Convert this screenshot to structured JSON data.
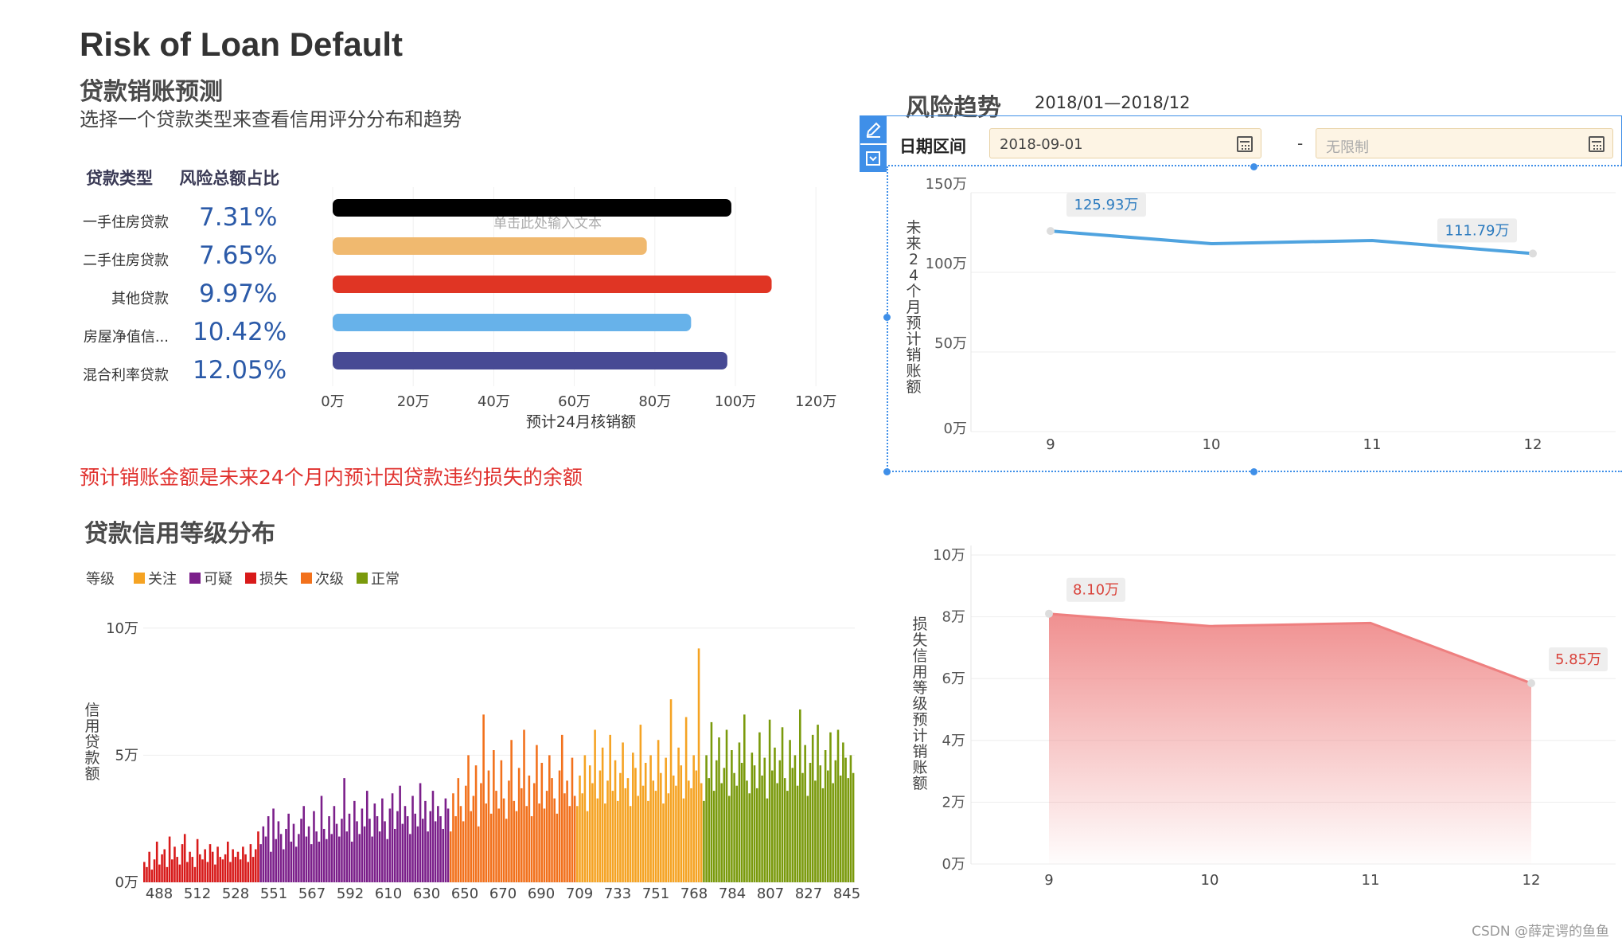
{
  "header": {
    "title": "Risk of Loan Default",
    "subtitle": "贷款销账预测",
    "description": "选择一个贷款类型来查看信用评分分布和趋势"
  },
  "loan_table": {
    "col1": "贷款类型",
    "col2": "风险总额占比",
    "rows": [
      {
        "type": "一手住房贷款",
        "pct": "7.31%",
        "color": "#000000"
      },
      {
        "type": "二手住房贷款",
        "pct": "7.65%",
        "color": "#f0b96f"
      },
      {
        "type": "其他贷款",
        "pct": "9.97%",
        "color": "#e03524"
      },
      {
        "type": "房屋净值信...",
        "pct": "10.42%",
        "color": "#67b2ea"
      },
      {
        "type": "混合利率贷款",
        "pct": "12.05%",
        "color": "#474a94"
      }
    ],
    "placeholder_text": "单击此处输入文本"
  },
  "note": "预计销账金额是未来24个月内预计因贷款违约损失的余额",
  "risk_trend": {
    "title": "风险趋势",
    "range_text": "2018/01—2018/12",
    "filter_label": "日期区间",
    "start_value": "2018-09-01",
    "end_placeholder": "无限制",
    "separator": "-"
  },
  "credit_section": {
    "title": "贷款信用等级分布"
  },
  "watermark": "CSDN @薛定谔的鱼鱼",
  "chart_data": [
    {
      "type": "bar",
      "orientation": "horizontal",
      "categories": [
        "一手住房贷款",
        "二手住房贷款",
        "其他贷款",
        "房屋净值信...",
        "混合利率贷款"
      ],
      "values": [
        99,
        78,
        109,
        89,
        98
      ],
      "xlabel": "预计24月核销额",
      "xticks": [
        "0万",
        "20万",
        "40万",
        "60万",
        "80万",
        "100万",
        "120万"
      ],
      "xlim": [
        0,
        120
      ],
      "colors": [
        "#000000",
        "#f0b96f",
        "#e03524",
        "#67b2ea",
        "#474a94"
      ],
      "grid": true
    },
    {
      "type": "line",
      "x": [
        "9",
        "10",
        "11",
        "12"
      ],
      "values": [
        125.93,
        118,
        120,
        111.79
      ],
      "point_labels": [
        "125.93万",
        "",
        "",
        "111.79万"
      ],
      "ylabel": "未来24个月预计销账额",
      "yticks": [
        "150万",
        "100万",
        "50万",
        "0万"
      ],
      "ylim": [
        0,
        150
      ],
      "color": "#4fa3df",
      "grid": true
    },
    {
      "type": "bar",
      "legend_title": "等级",
      "legend": [
        {
          "name": "关注",
          "color": "#f5a323"
        },
        {
          "name": "可疑",
          "color": "#7b1f8a"
        },
        {
          "name": "损失",
          "color": "#d81a1a"
        },
        {
          "name": "次级",
          "color": "#f2711c"
        },
        {
          "name": "正常",
          "color": "#7a9a0c"
        }
      ],
      "ylabel": "信用贷款额",
      "yticks": [
        "10万",
        "5万",
        "0万"
      ],
      "ylim": [
        0,
        10
      ],
      "xticks": [
        "488",
        "512",
        "528",
        "551",
        "567",
        "592",
        "610",
        "630",
        "650",
        "670",
        "690",
        "709",
        "733",
        "751",
        "768",
        "784",
        "807",
        "827",
        "845"
      ],
      "groups": [
        {
          "grade": "损失",
          "color": "#d81a1a",
          "x_from": 480,
          "x_to": 528,
          "bars": [
            0.8,
            0.6,
            1.2,
            0.5,
            0.9,
            1.6,
            0.7,
            1.1,
            1.3,
            0.6,
            1.8,
            0.9,
            1.4,
            1.0,
            0.7,
            1.5,
            1.9,
            0.8,
            1.2,
            1.0,
            0.6,
            1.7,
            1.1,
            0.9,
            1.3,
            0.8,
            1.5,
            1.2,
            0.7,
            1.4,
            1.0,
            0.9,
            1.1,
            1.6,
            0.8,
            1.3,
            1.0,
            1.2,
            0.9,
            1.4,
            1.1,
            0.8,
            1.5,
            1.0,
            1.3,
            2.0
          ]
        },
        {
          "grade": "可疑",
          "color": "#7b1f8a",
          "x_from": 528,
          "x_to": 630,
          "bars": [
            1.5,
            2.2,
            1.8,
            2.6,
            1.2,
            2.9,
            1.7,
            2.4,
            1.9,
            1.3,
            2.1,
            2.7,
            1.6,
            2.3,
            1.4,
            1.9,
            2.5,
            3.0,
            1.8,
            2.2,
            1.5,
            2.8,
            2.0,
            1.6,
            3.4,
            2.1,
            1.7,
            2.6,
            1.9,
            3.0,
            2.3,
            1.8,
            2.5,
            4.1,
            2.0,
            2.7,
            1.6,
            3.2,
            2.4,
            1.9,
            2.9,
            2.2,
            3.6,
            2.5,
            1.8,
            3.1,
            2.6,
            2.0,
            3.3,
            2.4,
            1.7,
            2.9,
            3.5,
            2.1,
            2.8,
            3.8,
            2.3,
            3.0,
            2.6,
            1.9,
            3.4,
            2.7,
            2.2,
            3.9,
            2.5,
            3.2,
            2.0,
            2.8,
            3.6,
            2.4,
            3.0,
            2.6,
            2.1,
            3.3,
            2.9
          ]
        },
        {
          "grade": "次级",
          "color": "#f2711c",
          "x_from": 630,
          "x_to": 700,
          "bars": [
            2.0,
            3.5,
            2.6,
            4.1,
            3.0,
            2.4,
            3.8,
            5.0,
            2.8,
            3.4,
            4.6,
            2.2,
            3.9,
            6.6,
            3.1,
            4.4,
            2.7,
            5.2,
            3.6,
            2.9,
            4.8,
            3.3,
            2.5,
            4.0,
            5.6,
            3.2,
            2.8,
            4.5,
            3.7,
            6.0,
            3.0,
            4.2,
            2.6,
            3.9,
            5.4,
            3.1,
            4.7,
            2.9,
            3.6,
            5.0,
            4.1,
            3.3,
            2.7,
            4.4,
            5.8,
            3.5,
            4.0,
            3.0,
            4.9,
            3.4
          ]
        },
        {
          "grade": "关注",
          "color": "#f5a323",
          "x_from": 700,
          "x_to": 768,
          "bars": [
            3.0,
            4.2,
            3.5,
            5.0,
            2.8,
            4.6,
            3.9,
            6.0,
            3.3,
            4.4,
            5.3,
            3.1,
            4.0,
            5.8,
            3.6,
            4.8,
            3.2,
            4.3,
            5.5,
            3.7,
            4.1,
            3.0,
            5.1,
            4.5,
            3.4,
            6.2,
            3.8,
            4.7,
            3.2,
            5.0,
            4.0,
            3.6,
            5.6,
            4.3,
            3.1,
            4.9,
            3.5,
            7.2,
            4.2,
            3.8,
            5.3,
            4.6,
            3.3,
            6.5,
            4.0,
            3.7,
            5.0,
            4.4,
            9.2,
            3.9
          ]
        },
        {
          "grade": "正常",
          "color": "#7a9a0c",
          "x_from": 768,
          "x_to": 850,
          "bars": [
            3.2,
            5.0,
            4.1,
            6.3,
            3.6,
            4.8,
            5.7,
            3.9,
            4.5,
            6.0,
            3.4,
            5.2,
            4.3,
            3.8,
            5.5,
            4.7,
            6.6,
            4.0,
            3.5,
            5.1,
            4.6,
            3.7,
            5.9,
            4.2,
            4.9,
            3.3,
            6.4,
            4.4,
            5.3,
            3.9,
            4.8,
            6.1,
            4.1,
            3.6,
            5.6,
            4.5,
            5.0,
            3.8,
            6.8,
            4.3,
            5.4,
            3.4,
            4.7,
            5.8,
            4.0,
            6.2,
            4.6,
            3.7,
            5.2,
            4.4,
            5.9,
            3.9,
            4.8,
            6.0,
            4.2,
            5.5,
            4.9,
            4.1,
            5.0,
            4.3
          ]
        }
      ]
    },
    {
      "type": "area",
      "x": [
        "9",
        "10",
        "11",
        "12"
      ],
      "values": [
        8.1,
        7.7,
        7.8,
        5.85
      ],
      "point_labels": [
        "8.10万",
        "",
        "",
        "5.85万"
      ],
      "ylabel": "损失信用等级预计销账额",
      "yticks": [
        "10万",
        "8万",
        "6万",
        "4万",
        "2万",
        "0万"
      ],
      "ylim": [
        0,
        10
      ],
      "color": "#ef8a8a",
      "grid": true
    }
  ]
}
